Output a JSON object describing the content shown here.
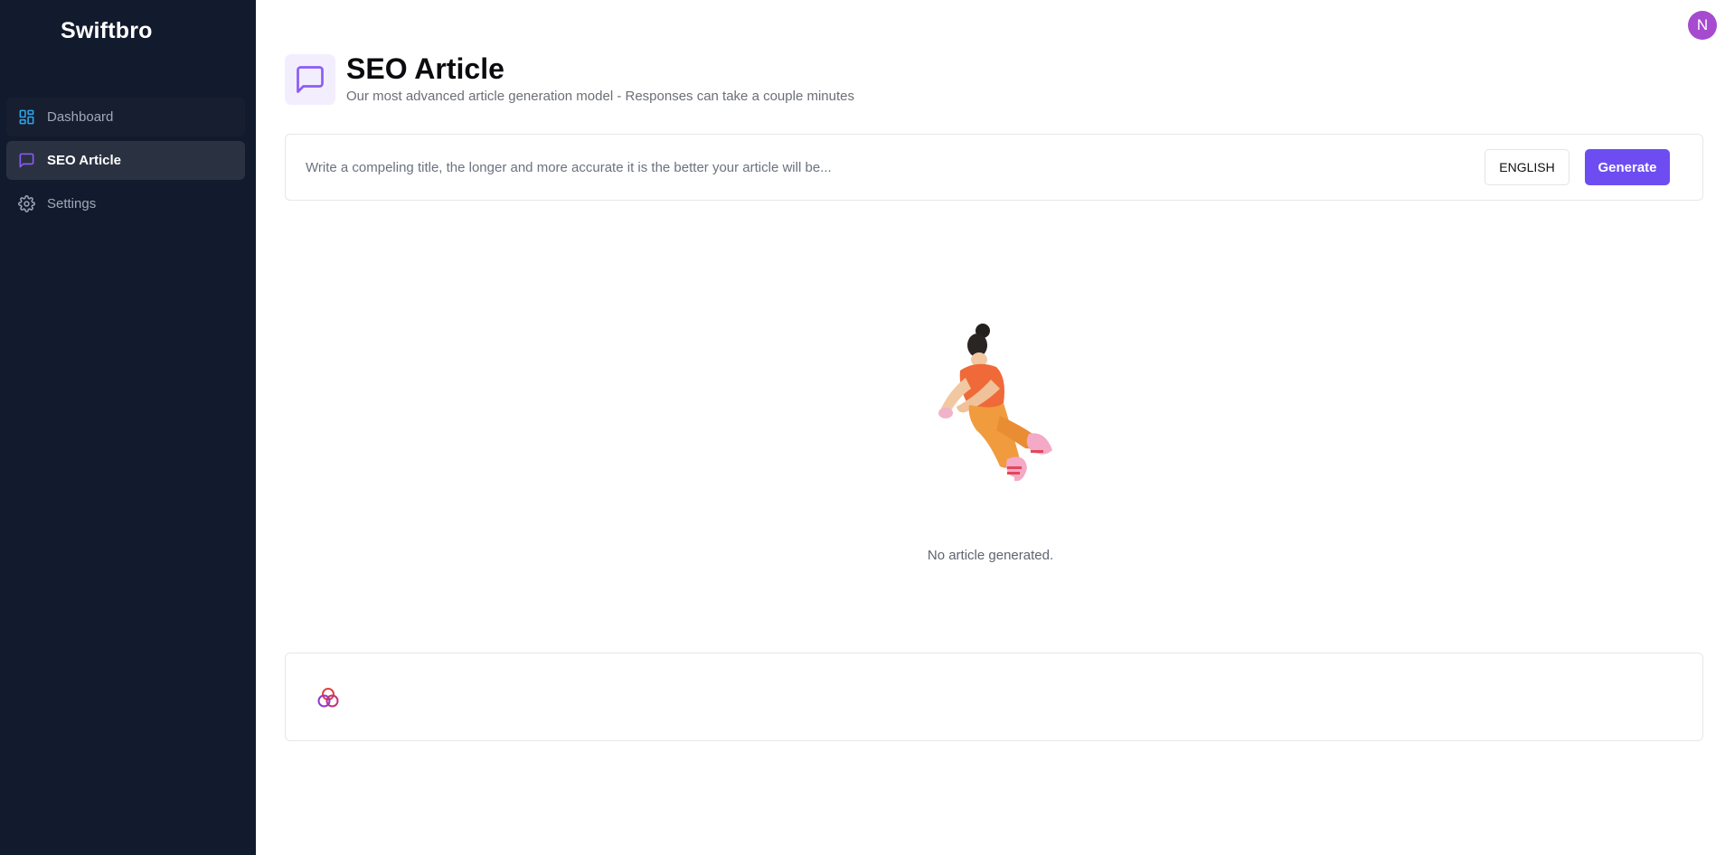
{
  "brand": {
    "name": "Swiftbro"
  },
  "sidebar": {
    "items": [
      {
        "label": "Dashboard",
        "icon": "dashboard-grid-icon",
        "active": false
      },
      {
        "label": "SEO Article",
        "icon": "message-square-icon",
        "active": true
      },
      {
        "label": "Settings",
        "icon": "gear-icon",
        "active": false
      }
    ]
  },
  "user": {
    "avatar_initial": "N"
  },
  "header": {
    "title": "SEO Article",
    "subtitle": "Our most advanced article generation model - Responses can take a couple minutes",
    "icon": "message-square-icon"
  },
  "prompt": {
    "placeholder": "Write a compeling title, the longer and more accurate it is the better your article will be...",
    "value": "",
    "language_label": "ENGLISH",
    "generate_label": "Generate"
  },
  "empty_state": {
    "message": "No article generated.",
    "illustration": "floating-person-illustration"
  },
  "output": {
    "icon": "interlocking-rings-logo-icon"
  },
  "colors": {
    "sidebar_bg": "#121a2d",
    "accent": "#6d4df2",
    "avatar": "#a64ad0",
    "dashboard_icon": "#2fa4e7",
    "active_icon": "#8b5cf6"
  }
}
